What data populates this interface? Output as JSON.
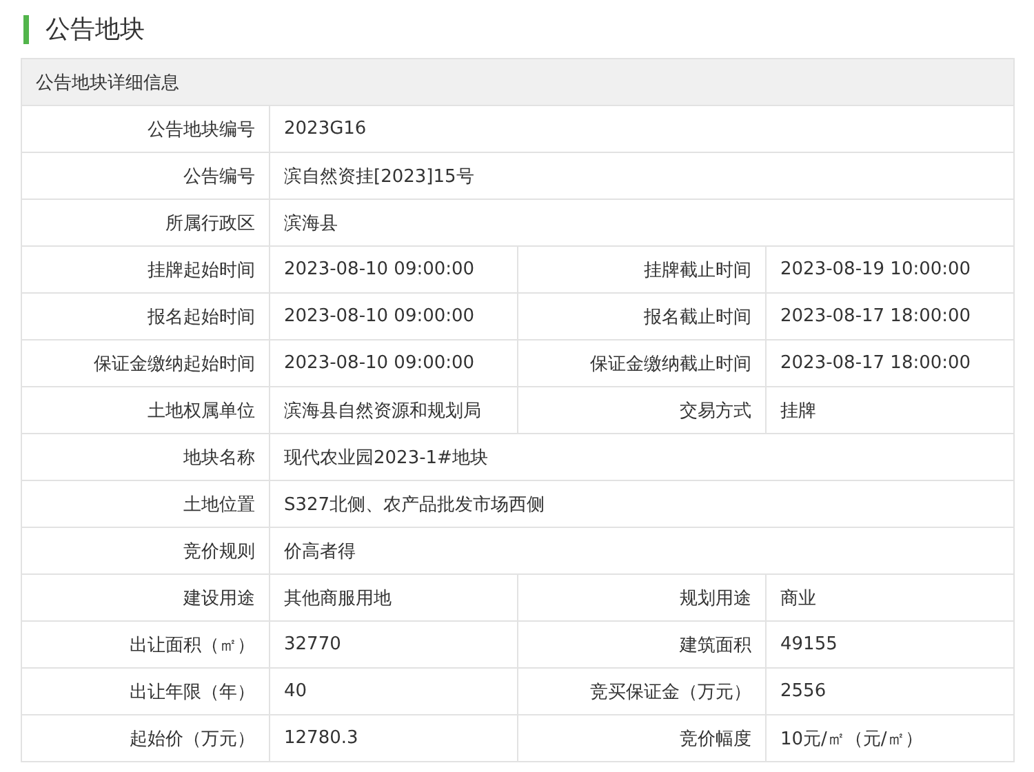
{
  "title": "公告地块",
  "table": {
    "heading": "公告地块详细信息",
    "rows": [
      [
        {
          "label": "公告地块编号",
          "value": "2023G16"
        }
      ],
      [
        {
          "label": "公告编号",
          "value": "滨自然资挂[2023]15号"
        }
      ],
      [
        {
          "label": "所属行政区",
          "value": "滨海县"
        }
      ],
      [
        {
          "label": "挂牌起始时间",
          "value": "2023-08-10 09:00:00"
        },
        {
          "label": "挂牌截止时间",
          "value": "2023-08-19 10:00:00"
        }
      ],
      [
        {
          "label": "报名起始时间",
          "value": "2023-08-10 09:00:00"
        },
        {
          "label": "报名截止时间",
          "value": "2023-08-17 18:00:00"
        }
      ],
      [
        {
          "label": "保证金缴纳起始时间",
          "value": "2023-08-10 09:00:00"
        },
        {
          "label": "保证金缴纳截止时间",
          "value": "2023-08-17 18:00:00"
        }
      ],
      [
        {
          "label": "土地权属单位",
          "value": "滨海县自然资源和规划局"
        },
        {
          "label": "交易方式",
          "value": "挂牌"
        }
      ],
      [
        {
          "label": "地块名称",
          "value": "现代农业园2023-1#地块"
        }
      ],
      [
        {
          "label": "土地位置",
          "value": "S327北侧、农产品批发市场西侧"
        }
      ],
      [
        {
          "label": "竞价规则",
          "value": "价高者得"
        }
      ],
      [
        {
          "label": "建设用途",
          "value": "其他商服用地"
        },
        {
          "label": "规划用途",
          "value": "商业"
        }
      ],
      [
        {
          "label": "出让面积（㎡）",
          "value": "32770"
        },
        {
          "label": "建筑面积",
          "value": "49155"
        }
      ],
      [
        {
          "label": "出让年限（年）",
          "value": "40"
        },
        {
          "label": "竞买保证金（万元）",
          "value": "2556"
        }
      ],
      [
        {
          "label": "起始价（万元）",
          "value": "12780.3"
        },
        {
          "label": "竞价幅度",
          "value": "10元/㎡（元/㎡）"
        }
      ]
    ]
  }
}
